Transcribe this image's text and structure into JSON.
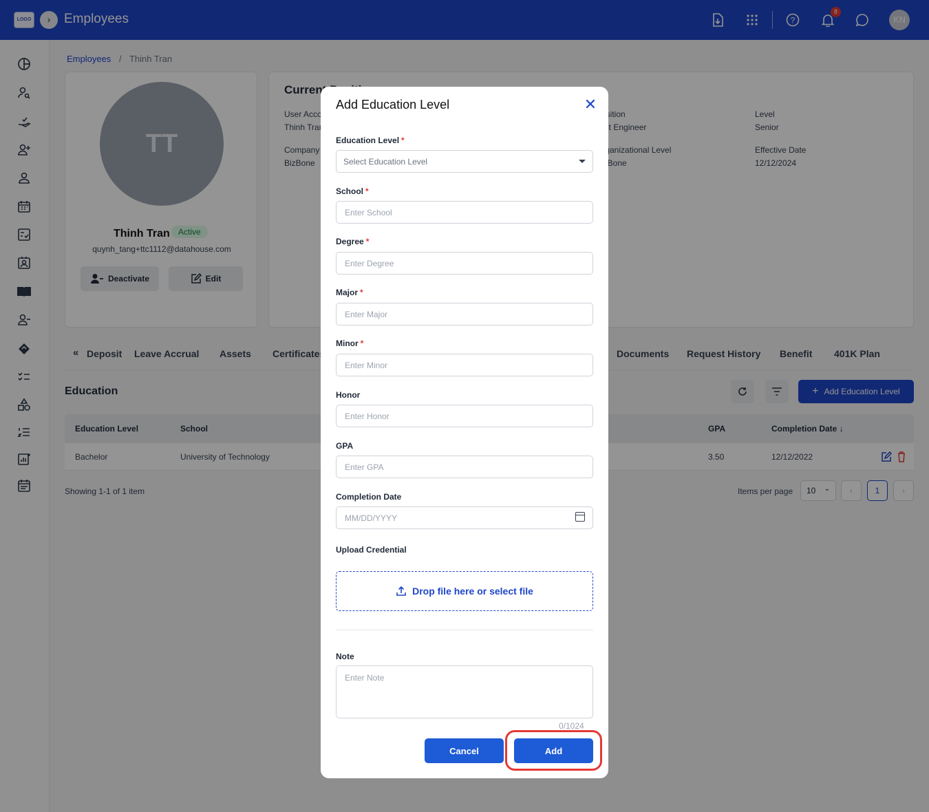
{
  "header": {
    "logo": "LOGO",
    "title": "Employees",
    "notification_count": "8",
    "user_initials": "KN"
  },
  "breadcrumb": {
    "root": "Employees",
    "separator": "/",
    "current": "Thinh Tran"
  },
  "profile": {
    "initials": "TT",
    "name": "Thinh Tran",
    "status": "Active",
    "email": "quynh_tang+ttc1112@datahouse.com",
    "deactivate_label": "Deactivate",
    "edit_label": "Edit"
  },
  "position": {
    "title": "Current Position",
    "fields": [
      {
        "label": "User Account",
        "value": "Thinh Tran"
      },
      {
        "label": "Position",
        "value": "Test Engineer"
      },
      {
        "label": "Level",
        "value": "Senior"
      },
      {
        "label": "Company",
        "value": "BizBone"
      },
      {
        "label": "Organizational Level",
        "value": "BizBone"
      },
      {
        "label": "Effective Date",
        "value": "12/12/2024"
      }
    ]
  },
  "tabs": [
    "Deposit",
    "Leave Accrual",
    "Assets",
    "Certificates",
    "Documents",
    "Request History",
    "Benefit",
    "401K Plan"
  ],
  "education": {
    "title": "Education",
    "add_label": "Add Education Level",
    "columns": [
      "Education Level",
      "School",
      "GPA",
      "Completion Date"
    ],
    "rows": [
      {
        "level": "Bachelor",
        "school": "University of Technology",
        "gpa": "3.50",
        "completion": "12/12/2022"
      }
    ],
    "showing": "Showing 1-1 of 1 item",
    "items_per_page_label": "Items per page",
    "items_per_page": "10",
    "current_page": "1"
  },
  "modal": {
    "title": "Add Education Level",
    "fields": {
      "education_level": {
        "label": "Education Level",
        "placeholder": "Select Education Level"
      },
      "school": {
        "label": "School",
        "placeholder": "Enter School"
      },
      "degree": {
        "label": "Degree",
        "placeholder": "Enter Degree"
      },
      "major": {
        "label": "Major",
        "placeholder": "Enter Major"
      },
      "minor": {
        "label": "Minor",
        "placeholder": "Enter Minor"
      },
      "honor": {
        "label": "Honor",
        "placeholder": "Enter Honor"
      },
      "gpa": {
        "label": "GPA",
        "placeholder": "Enter GPA"
      },
      "completion_date": {
        "label": "Completion Date",
        "placeholder": "MM/DD/YYYY"
      },
      "upload": {
        "label": "Upload Credential",
        "action": "Drop file here or select file"
      },
      "note": {
        "label": "Note",
        "placeholder": "Enter Note",
        "counter": "0/1024"
      }
    },
    "required_mark": "*",
    "cancel_label": "Cancel",
    "add_label": "Add"
  },
  "colors": {
    "primary": "#1e46c8",
    "required": "#e53935",
    "highlight": "#e53935"
  }
}
